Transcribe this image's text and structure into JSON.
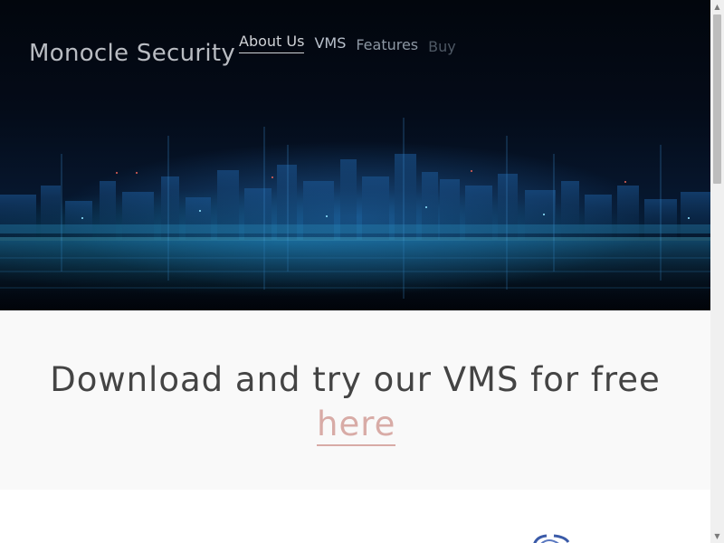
{
  "header": {
    "brand": "Monocle Security",
    "nav": [
      {
        "label": "About Us"
      },
      {
        "label": "VMS"
      },
      {
        "label": "Features"
      },
      {
        "label": "Buy"
      }
    ]
  },
  "cta": {
    "text": "Download and try our VMS for free",
    "link_text": "here"
  },
  "colors": {
    "hero_background": "#040b18",
    "cta_background": "#f9f9f9",
    "cta_text": "#444444",
    "link_accent": "#d8aba6",
    "logo_blue": "#3a5aa8"
  },
  "icons": {
    "scroll_up": "▲",
    "scroll_down": "▼"
  }
}
